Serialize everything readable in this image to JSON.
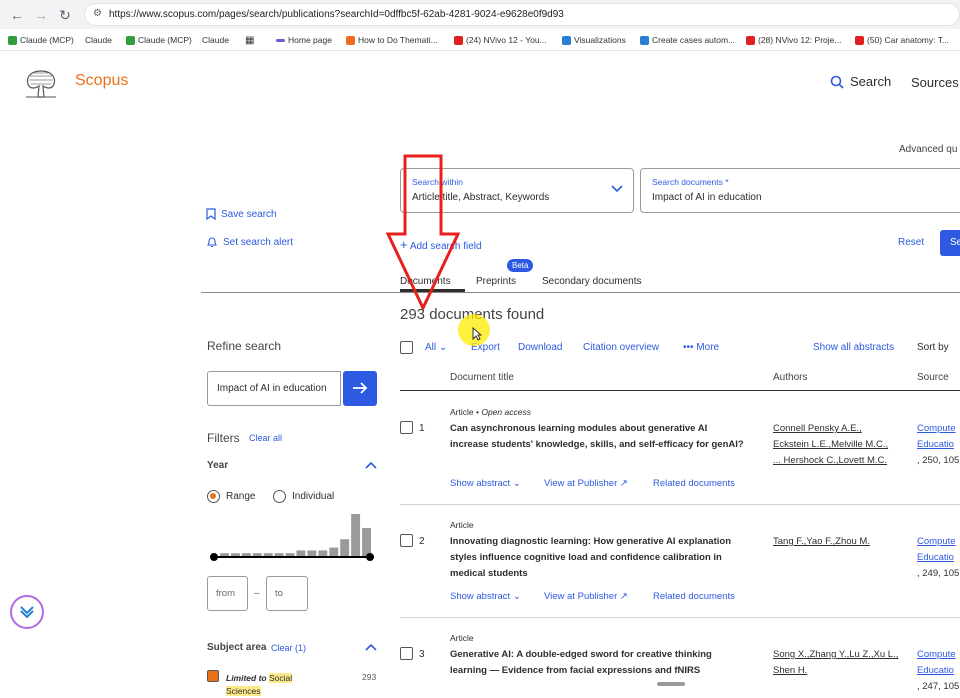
{
  "browser": {
    "url": "https://www.scopus.com/pages/search/publications?searchId=0dffbc5f-62ab-4281-9024-e9628e0f9d93",
    "bookmarks": [
      {
        "label": "Claude (MCP)",
        "color": "#2e9e3a"
      },
      {
        "label": "Claude",
        "color": ""
      },
      {
        "label": "Claude (MCP)",
        "color": "#2e9e3a"
      },
      {
        "label": "Claude",
        "color": ""
      },
      {
        "label": "Home page",
        "color": "#6a5acd"
      },
      {
        "label": "How to Do Themati...",
        "color": "#f06a22"
      },
      {
        "label": "(24) NVivo 12 - You...",
        "color": "#e02020"
      },
      {
        "label": "Visualizations",
        "color": "#2a7fd4"
      },
      {
        "label": "Create cases autom...",
        "color": "#2a7fd4"
      },
      {
        "label": "(28) NVivo 12: Proje...",
        "color": "#e02020"
      },
      {
        "label": "(50) Car anatomy: T...",
        "color": "#e02020"
      }
    ]
  },
  "header": {
    "logo_text": "Scopus",
    "search_label": "Search",
    "sources_label": "Sources",
    "advanced_query": "Advanced qu"
  },
  "search": {
    "within_label": "Search within",
    "within_value": "Article title, Abstract, Keywords",
    "documents_label": "Search documents *",
    "documents_value": "Impact of AI in education",
    "add_field": "Add search field",
    "reset": "Reset",
    "search_btn": "Se"
  },
  "sidebar_actions": {
    "save_search": "Save search",
    "set_alert": "Set search alert"
  },
  "tabs": {
    "documents": "Documents",
    "preprints": "Preprints",
    "beta": "Beta",
    "secondary": "Secondary documents"
  },
  "results": {
    "count_text": "293 documents found",
    "toolbar": {
      "all": "All",
      "export": "Export",
      "download": "Download",
      "citation_overview": "Citation overview",
      "more": "More",
      "show_all_abstracts": "Show all abstracts",
      "sort_by": "Sort by"
    },
    "columns": {
      "title": "Document title",
      "authors": "Authors",
      "source": "Source"
    },
    "links": {
      "show_abstract": "Show abstract",
      "view_publisher": "View at Publisher",
      "related": "Related documents"
    },
    "items": [
      {
        "num": "1",
        "type": "Article",
        "access": "Open access",
        "title_lines": [
          "Can asynchronous learning modules about generative AI",
          "increase students' knowledge, skills, and self-efficacy for genAI?"
        ],
        "author_lines": [
          "Connell Pensky A.E.,",
          "Eckstein L.E.,Melville M.C.,",
          "... Hershock C.,Lovett M.C."
        ],
        "source_lines": [
          "Compute",
          "Educatio",
          ", 250, 105"
        ]
      },
      {
        "num": "2",
        "type": "Article",
        "access": "",
        "title_lines": [
          "Innovating diagnostic learning: How generative AI explanation",
          "styles influence cognitive load and confidence calibration in",
          "medical students"
        ],
        "author_lines": [
          "Tang F.,Yao F.,Zhou M."
        ],
        "source_lines": [
          "Compute",
          "Educatio",
          ", 249, 105"
        ]
      },
      {
        "num": "3",
        "type": "Article",
        "access": "",
        "title_lines": [
          "Generative AI: A double-edged sword for creative thinking",
          "learning — Evidence from facial expressions and fNIRS"
        ],
        "author_lines": [
          "Song X.,Zhang Y.,Lu Z.,Xu L.,",
          "Shen H."
        ],
        "source_lines": [
          "Compute",
          "Educatio",
          ", 247, 105"
        ]
      }
    ]
  },
  "refine": {
    "title": "Refine search",
    "input_value": "Impact of AI in education",
    "filters_label": "Filters",
    "clear_all": "Clear all",
    "year_label": "Year",
    "range_label": "Range",
    "individual_label": "Individual",
    "year_histogram": [
      1,
      1,
      1,
      1,
      1,
      1,
      1,
      2,
      2,
      2,
      3,
      6,
      15,
      10
    ],
    "from_placeholder": "from",
    "to_placeholder": "to",
    "subject_label": "Subject area",
    "subject_clear": "Clear (1)",
    "subject_item_prefix": "Limited to",
    "subject_item_word": "Social",
    "subject_item_cont": "Sciences",
    "subject_item_count": "293"
  },
  "colors": {
    "accent": "#2d5ae0",
    "brand": "#e9711c",
    "arrow": "#e8201c"
  }
}
